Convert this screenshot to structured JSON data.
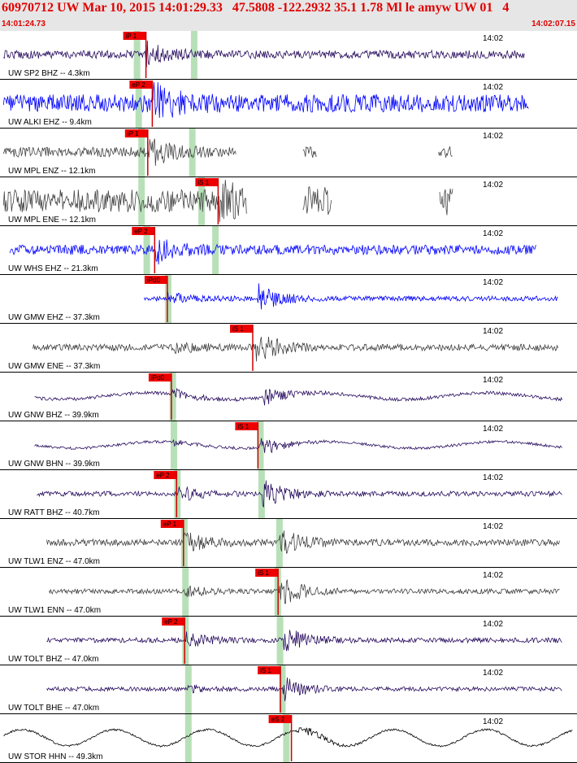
{
  "header": {
    "title": "60970712 UW Mar 10, 2015 14:01:29.33   47.5808 -122.2932 35.1 1.78 Ml le amyw UW 01   4",
    "start_time": "14:01:24.73",
    "end_time": "14:02:07.15"
  },
  "colors": {
    "pick_fill": "#ee0000",
    "pick_line": "#cc0000",
    "window_band": "#b8e0b8",
    "row_rule": "#000000",
    "blue_trace": "#0000ff",
    "purple_trace": "#2a0f60",
    "gray_trace": "#444444",
    "black_trace": "#000000"
  },
  "panels": [
    {
      "label": "UW SP2 BHZ -- 4.3km",
      "time_tick": "14:02",
      "trace_color": "purple",
      "amp": 5,
      "span": [
        0.006,
        0.91
      ],
      "gaps": [],
      "bands": [
        0.236,
        0.335
      ],
      "picks": [
        {
          "label": "iP 1",
          "t": 0.253
        }
      ],
      "events": [
        {
          "t": 0.253,
          "amp": 2.8
        }
      ]
    },
    {
      "label": "UW ALKI EHZ -- 9.4km",
      "time_tick": "14:02",
      "trace_color": "blue",
      "amp": 11,
      "span": [
        0.006,
        0.916
      ],
      "gaps": [],
      "bands": [
        0.239
      ],
      "picks": [
        {
          "label": "eP 2",
          "t": 0.264
        }
      ],
      "events": [
        {
          "t": 0.265,
          "amp": 1.8
        }
      ]
    },
    {
      "label": "UW MPL ENZ -- 12.1km",
      "time_tick": "14:02",
      "trace_color": "gray",
      "amp": 6,
      "span": [
        0.006,
        0.41
      ],
      "gaps": [],
      "bursts": [
        [
          0.525,
          0.55
        ],
        [
          0.76,
          0.785
        ]
      ],
      "bands": [
        0.244,
        0.332
      ],
      "picks": [
        {
          "label": "iP 1",
          "t": 0.256
        }
      ],
      "events": [
        {
          "t": 0.257,
          "amp": 2.8
        }
      ]
    },
    {
      "label": "UW MPL ENE -- 12.1km",
      "time_tick": "14:02",
      "trace_color": "gray",
      "amp": 14,
      "span": [
        0.006,
        0.428
      ],
      "gaps": [],
      "bursts": [
        [
          0.525,
          0.575
        ],
        [
          0.762,
          0.785
        ]
      ],
      "bands": [
        0.244,
        0.348
      ],
      "picks": [
        {
          "label": "iS 1",
          "t": 0.378
        }
      ],
      "events": [
        {
          "t": 0.378,
          "amp": 1.5
        }
      ]
    },
    {
      "label": "UW WHS EHZ -- 21.3km",
      "time_tick": "14:02",
      "trace_color": "blue",
      "amp": 6,
      "span": [
        0.017,
        0.93
      ],
      "gaps": [],
      "bands": [
        0.253,
        0.372
      ],
      "picks": [
        {
          "label": "eP 2",
          "t": 0.268
        }
      ],
      "events": [
        {
          "t": 0.27,
          "amp": 2.4
        }
      ]
    },
    {
      "label": "UW GMW EHZ -- 37.3km",
      "time_tick": "14:02",
      "trace_color": "blue",
      "amp": 3,
      "span": [
        0.25,
        0.967
      ],
      "gaps": [],
      "bands": [
        0.29
      ],
      "picks": [
        {
          "label": "iPd0",
          "t": 0.29
        }
      ],
      "events": [
        {
          "t": 0.29,
          "amp": 2.2
        },
        {
          "t": 0.447,
          "amp": 5.5
        }
      ]
    },
    {
      "label": "UW GMW ENE -- 37.3km",
      "time_tick": "14:02",
      "trace_color": "gray",
      "amp": 4,
      "span": [
        0.057,
        0.967
      ],
      "gaps": [],
      "bands": [],
      "picks": [
        {
          "label": "iS 1",
          "t": 0.438
        }
      ],
      "events": [
        {
          "t": 0.3,
          "amp": 1.5
        },
        {
          "t": 0.443,
          "amp": 5
        }
      ]
    },
    {
      "label": "UW GNW BHZ -- 39.9km",
      "time_tick": "14:02",
      "trace_color": "purple",
      "amp": 2,
      "span": [
        0.06,
        0.975
      ],
      "gaps": [],
      "bands": [
        0.298
      ],
      "picks": [
        {
          "label": "iPd0",
          "t": 0.297
        }
      ],
      "events": [
        {
          "t": 0.298,
          "amp": 4
        },
        {
          "t": 0.455,
          "amp": 6
        }
      ]
    },
    {
      "label": "UW GNW BHN -- 39.9km",
      "time_tick": "14:02",
      "trace_color": "purple",
      "amp": 1.6,
      "span": [
        0.06,
        0.975
      ],
      "gaps": [],
      "bands": [
        0.3,
        0.45
      ],
      "picks": [
        {
          "label": "iS 1",
          "t": 0.447
        }
      ],
      "events": [
        {
          "t": 0.3,
          "amp": 2
        },
        {
          "t": 0.449,
          "amp": 8
        }
      ]
    },
    {
      "label": "UW RATT BHZ -- 40.7km",
      "time_tick": "14:02",
      "trace_color": "purple",
      "amp": 3,
      "span": [
        0.064,
        0.975
      ],
      "gaps": [],
      "bands": [
        0.306,
        0.452
      ],
      "picks": [
        {
          "label": "eP 2",
          "t": 0.306
        }
      ],
      "events": [
        {
          "t": 0.31,
          "amp": 3
        },
        {
          "t": 0.455,
          "amp": 6
        }
      ]
    },
    {
      "label": "UW TLW1 ENZ -- 47.0km",
      "time_tick": "14:02",
      "trace_color": "gray",
      "amp": 4,
      "span": [
        0.081,
        0.97
      ],
      "gaps": [],
      "bands": [
        0.318,
        0.483
      ],
      "picks": [
        {
          "label": "eP 1",
          "t": 0.318
        }
      ],
      "events": [
        {
          "t": 0.318,
          "amp": 3
        },
        {
          "t": 0.485,
          "amp": 4
        }
      ]
    },
    {
      "label": "UW TLW1 ENN -- 47.0km",
      "time_tick": "14:02",
      "trace_color": "gray",
      "amp": 3,
      "span": [
        0.085,
        0.97
      ],
      "gaps": [],
      "bands": [
        0.32,
        0.48
      ],
      "picks": [
        {
          "label": "iS 1",
          "t": 0.482
        }
      ],
      "events": [
        {
          "t": 0.32,
          "amp": 2
        },
        {
          "t": 0.485,
          "amp": 6
        }
      ]
    },
    {
      "label": "UW TOLT BHZ -- 47.0km",
      "time_tick": "14:02",
      "trace_color": "purple",
      "amp": 3,
      "span": [
        0.081,
        0.975
      ],
      "gaps": [],
      "bands": [
        0.32,
        0.484
      ],
      "picks": [
        {
          "label": "eP 2",
          "t": 0.32
        }
      ],
      "events": [
        {
          "t": 0.322,
          "amp": 3
        },
        {
          "t": 0.49,
          "amp": 6
        }
      ]
    },
    {
      "label": "UW TOLT BHE -- 47.0km",
      "time_tick": "14:02",
      "trace_color": "purple",
      "amp": 2.5,
      "span": [
        0.081,
        0.975
      ],
      "gaps": [],
      "bands": [
        0.325,
        0.488
      ],
      "picks": [
        {
          "label": "iS 1",
          "t": 0.486
        }
      ],
      "events": [
        {
          "t": 0.325,
          "amp": 1.5
        },
        {
          "t": 0.49,
          "amp": 6
        }
      ]
    },
    {
      "label": "UW STOR HHN -- 49.3km",
      "time_tick": "14:02",
      "trace_color": "black",
      "amp": 1.2,
      "span": [
        0.006,
        0.993
      ],
      "gaps": [],
      "bands": [
        0.325,
        0.495
      ],
      "picks": [
        {
          "label": "eS 2",
          "t": 0.505
        }
      ],
      "events": [
        {
          "t": 0.51,
          "amp": 8
        }
      ]
    }
  ]
}
